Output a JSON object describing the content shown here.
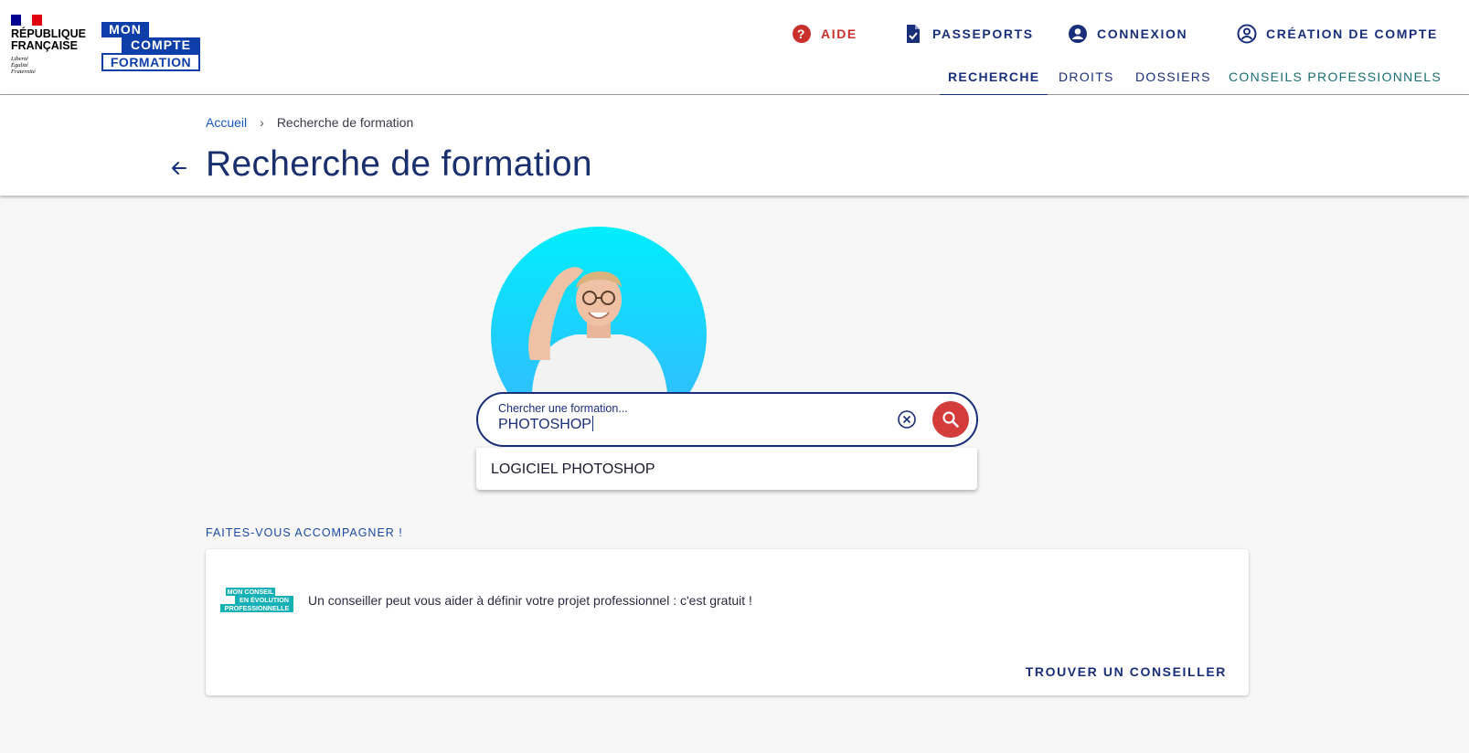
{
  "brand": {
    "republique_line1": "RÉPUBLIQUE",
    "republique_line2": "FRANÇAISE",
    "motto_1": "Liberté",
    "motto_2": "Égalité",
    "motto_3": "Fraternité",
    "logo_line1": "MON",
    "logo_line2": "COMPTE",
    "logo_line3": "FORMATION"
  },
  "top_nav": {
    "aide": "AIDE",
    "passeports": "PASSEPORTS",
    "connexion": "CONNEXION",
    "creation": "CRÉATION DE COMPTE"
  },
  "sub_nav": {
    "recherche": "RECHERCHE",
    "droits": "DROITS",
    "dossiers": "DOSSIERS",
    "conseils": "CONSEILS PROFESSIONNELS"
  },
  "breadcrumb": {
    "home": "Accueil",
    "current": "Recherche de formation"
  },
  "page_title": "Recherche de formation",
  "search": {
    "label": "Chercher une formation...",
    "value": "PHOTOSHOP"
  },
  "suggestions": [
    "LOGICIEL PHOTOSHOP"
  ],
  "accompagnement": {
    "title": "FAITES-VOUS ACCOMPAGNER !",
    "cep_line1": "MON CONSEIL",
    "cep_line2": "EN ÉVOLUTION",
    "cep_line3": "PROFESSIONNELLE",
    "text": "Un conseiller peut vous aider à définir votre projet professionnel : c'est gratuit !",
    "cta": "TROUVER UN CONSEILLER"
  },
  "colors": {
    "primary": "#1a2f7a",
    "accent_red": "#d43b3b",
    "brand_blue": "#0e3fa8",
    "teal": "#16b0b7"
  }
}
